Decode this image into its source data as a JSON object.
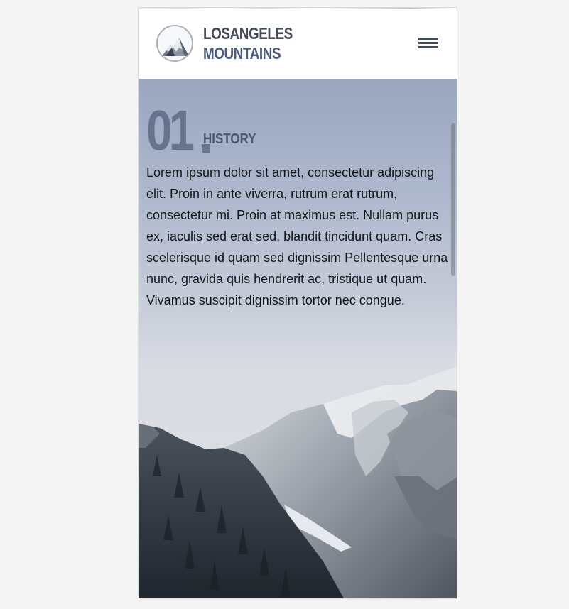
{
  "header": {
    "brand_line1": "LOSANGELES",
    "brand_line2": "MOUNTAINS",
    "logo_icon": "mountain-logo-icon",
    "menu_icon": "hamburger-menu-icon"
  },
  "section": {
    "number": "01",
    "title": "HISTORY",
    "body": "Lorem ipsum dolor sit amet, consectetur adipiscing elit. Proin in ante viverra, rutrum erat rutrum, consectetur mi. Proin at maximus est. Nullam purus ex, iaculis sed erat sed, blandit tincidunt quam. Cras scelerisque id quam sed dignissim Pellentesque urna nunc, gravida quis hendrerit ac, tristique ut quam. Vivamus suscipit dignissim tortor nec congue."
  },
  "colors": {
    "accent": "#4a5a7c",
    "brand_dark": "#454c57",
    "menu": "#3c4a68",
    "page_background": "#f4f4f4"
  }
}
